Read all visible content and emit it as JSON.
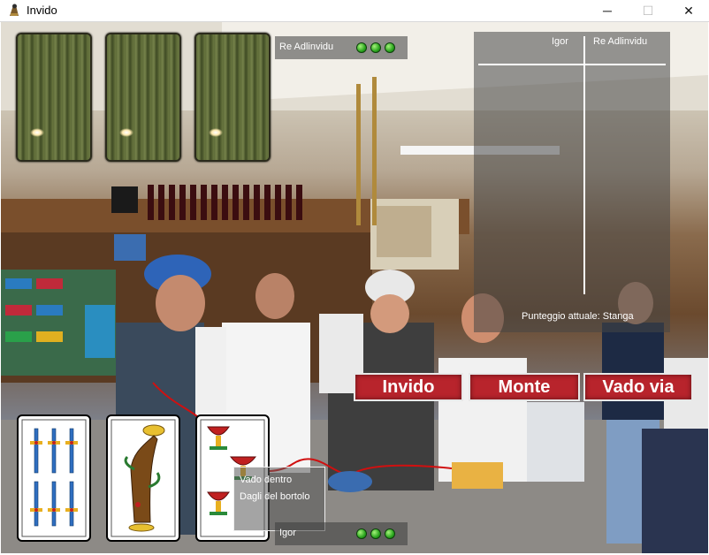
{
  "window": {
    "title": "Invido",
    "app_icon": "game-app-icon",
    "minimize": "─",
    "maximize": "☐",
    "close": "✕"
  },
  "opponent": {
    "name": "Re Adlinvidu",
    "turn_dots": 3,
    "cards_face_down": 3
  },
  "player": {
    "name": "Igor",
    "turn_dots": 3
  },
  "scoreboard": {
    "col1": "Igor",
    "col2": "Re Adlinvidu",
    "status": "Punteggio attuale: Stanga"
  },
  "actions": [
    {
      "label": "Invido"
    },
    {
      "label": "Monte"
    },
    {
      "label": "Vado via"
    }
  ],
  "hand": [
    {
      "suit": "spade",
      "rank": 6
    },
    {
      "suit": "bastoni",
      "rank": 1
    },
    {
      "suit": "coppe",
      "rank": 3
    }
  ],
  "context_menu": {
    "items": [
      "Vado dentro",
      "Dagli del bortolo"
    ]
  },
  "colors": {
    "action_button": "#b8242c",
    "panel": "#3c3c3c",
    "dot": "#2aa51e"
  }
}
